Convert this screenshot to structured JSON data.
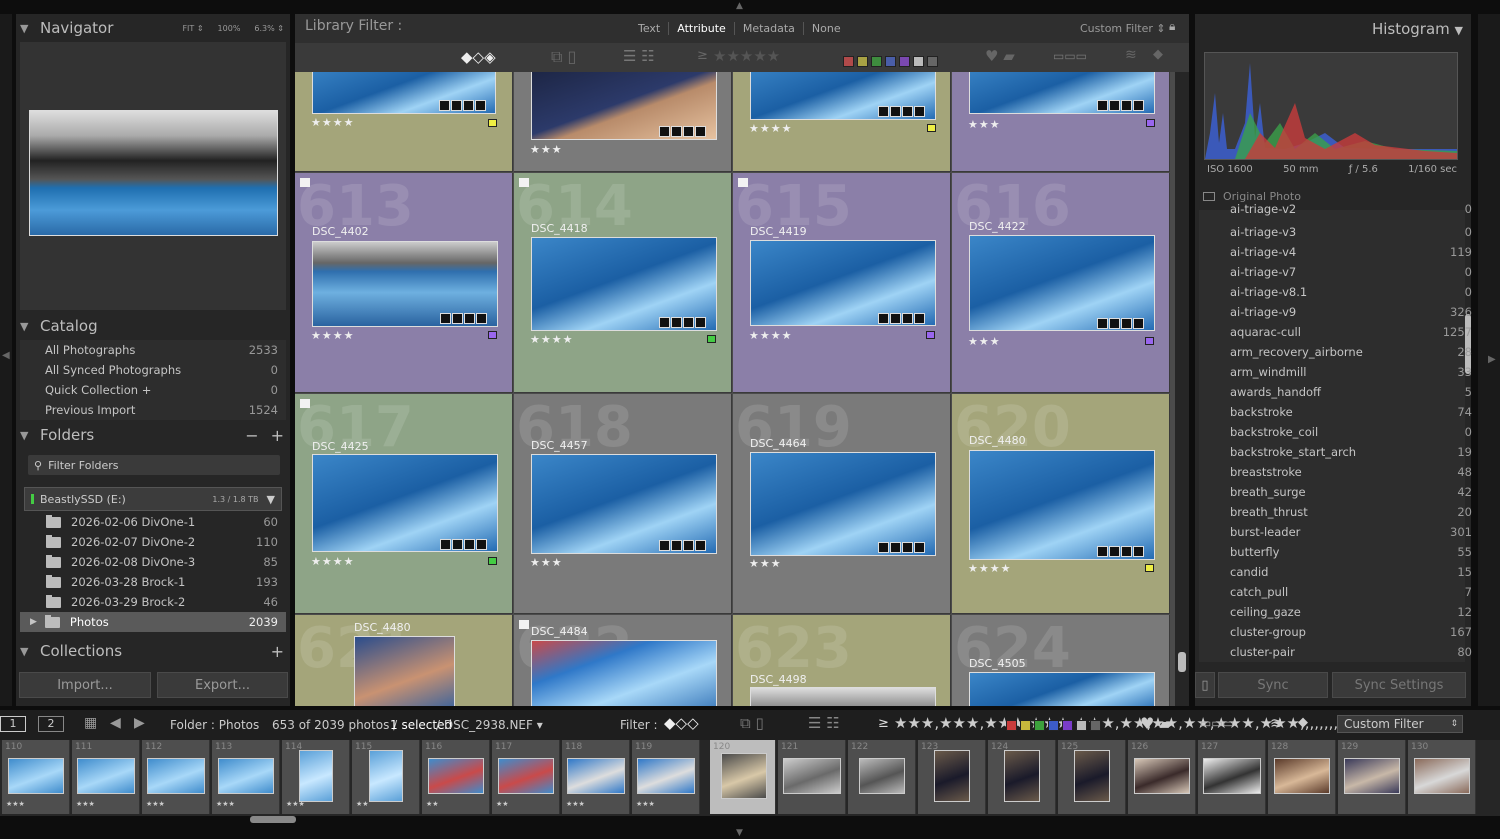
{
  "navigator": {
    "title": "Navigator",
    "zoom": [
      "FIT ⇕",
      "100%",
      "6.3% ⇕"
    ]
  },
  "catalog": {
    "title": "Catalog",
    "items": [
      {
        "label": "All Photographs",
        "count": "2533"
      },
      {
        "label": "All Synced Photographs",
        "count": "0"
      },
      {
        "label": "Quick Collection  +",
        "count": "0"
      },
      {
        "label": "Previous Import",
        "count": "1524"
      }
    ]
  },
  "folders": {
    "title": "Folders",
    "minus": "−",
    "plus": "+",
    "filter_placeholder": "Filter Folders",
    "volume": {
      "name": "BeastlySSD (E:)",
      "space": "1.3 / 1.8 TB"
    },
    "items": [
      {
        "label": "2026-02-06 DivOne-1",
        "count": "60"
      },
      {
        "label": "2026-02-07 DivOne-2",
        "count": "110"
      },
      {
        "label": "2026-02-08 DivOne-3",
        "count": "85"
      },
      {
        "label": "2026-03-28 Brock-1",
        "count": "193"
      },
      {
        "label": "2026-03-29 Brock-2",
        "count": "46"
      },
      {
        "label": "Photos",
        "count": "2039"
      }
    ]
  },
  "collections": {
    "title": "Collections",
    "plus": "+"
  },
  "buttons": {
    "import": "Import...",
    "export": "Export...",
    "sync": "Sync",
    "sync_settings": "Sync Settings"
  },
  "library_filter": {
    "title": "Library Filter :",
    "tabs": [
      "Text",
      "Attribute",
      "Metadata",
      "None"
    ],
    "active": "Attribute",
    "custom": "Custom Filter ⇕",
    "gte": "≥",
    "stars": "★★★★★"
  },
  "colors": {
    "red": "#c84a4a",
    "yellow": "#c8c24a",
    "green": "#4aa04a",
    "blue": "#4a6ac8",
    "purple": "#8a4ac8",
    "label_purple": "#9966ee",
    "label_green": "#44cc44",
    "label_yellow": "#eeee44"
  },
  "grid": {
    "top_row": [
      {
        "stars": "★★★★",
        "label": "yellow"
      },
      {
        "stars": "★★★",
        "label": "none"
      },
      {
        "stars": "★★★★",
        "label": "yellow"
      },
      {
        "stars": "★★★",
        "label": "purple"
      }
    ],
    "rows": [
      [
        {
          "num": "613",
          "name": "DSC_4402",
          "stars": "★★★★",
          "label": "purple",
          "flag": true,
          "bg": "#8b7fa8"
        },
        {
          "num": "614",
          "name": "DSC_4418",
          "stars": "★★★★",
          "label": "green",
          "flag": true,
          "bg": "#8ea487"
        },
        {
          "num": "615",
          "name": "DSC_4419",
          "stars": "★★★★",
          "label": "purple",
          "flag": true,
          "bg": "#8b7fa8"
        },
        {
          "num": "616",
          "name": "DSC_4422",
          "stars": "★★★",
          "label": "purple",
          "flag": false,
          "bg": "#8b7fa8"
        }
      ],
      [
        {
          "num": "617",
          "name": "DSC_4425",
          "stars": "★★★★",
          "label": "green",
          "flag": true,
          "bg": "#8ea487"
        },
        {
          "num": "618",
          "name": "DSC_4457",
          "stars": "★★★",
          "label": "none",
          "flag": false,
          "bg": "#7a7a7a"
        },
        {
          "num": "619",
          "name": "DSC_4464",
          "stars": "★★★",
          "label": "none",
          "flag": false,
          "bg": "#7a7a7a"
        },
        {
          "num": "620",
          "name": "DSC_4480",
          "stars": "★★★★",
          "label": "yellow",
          "flag": false,
          "bg": "#a4a57a"
        }
      ],
      [
        {
          "num": "621",
          "name": "DSC_4480",
          "bg": "#a4a57a",
          "flag": false
        },
        {
          "num": "622",
          "name": "DSC_4484",
          "bg": "#7a7a7a",
          "flag": true
        },
        {
          "num": "623",
          "name": "DSC_4498",
          "bg": "#a4a57a",
          "flag": false
        },
        {
          "num": "624",
          "name": "DSC_4505",
          "bg": "#7a7a7a",
          "flag": false
        }
      ]
    ]
  },
  "histogram": {
    "title": "Histogram",
    "iso": "ISO 1600",
    "focal": "50 mm",
    "aperture": "ƒ / 5.6",
    "shutter": "1/160 sec",
    "original": "Original Photo"
  },
  "keywords": [
    {
      "label": "ai-triage-v2",
      "count": "0"
    },
    {
      "label": "ai-triage-v3",
      "count": "0"
    },
    {
      "label": "ai-triage-v4",
      "count": "119"
    },
    {
      "label": "ai-triage-v7",
      "count": "0"
    },
    {
      "label": "ai-triage-v8.1",
      "count": "0"
    },
    {
      "label": "ai-triage-v9",
      "count": "326"
    },
    {
      "label": "aquarac-cull",
      "count": "1257"
    },
    {
      "label": "arm_recovery_airborne",
      "count": "28"
    },
    {
      "label": "arm_windmill",
      "count": "33"
    },
    {
      "label": "awards_handoff",
      "count": "5"
    },
    {
      "label": "backstroke",
      "count": "74"
    },
    {
      "label": "backstroke_coil",
      "count": "0"
    },
    {
      "label": "backstroke_start_arch",
      "count": "19"
    },
    {
      "label": "breaststroke",
      "count": "48"
    },
    {
      "label": "breath_surge",
      "count": "42"
    },
    {
      "label": "breath_thrust",
      "count": "20"
    },
    {
      "label": "burst-leader",
      "count": "301"
    },
    {
      "label": "butterfly",
      "count": "55"
    },
    {
      "label": "candid",
      "count": "15"
    },
    {
      "label": "catch_pull",
      "count": "7"
    },
    {
      "label": "ceiling_gaze",
      "count": "12"
    },
    {
      "label": "cluster-group",
      "count": "167"
    },
    {
      "label": "cluster-pair",
      "count": "80"
    }
  ],
  "filmstrip": {
    "screen1": "1",
    "screen2": "2",
    "folder": "Folder : Photos",
    "info": "653 of 2039 photos /",
    "selected": "1 selected",
    "file": "/ DSC_2938.NEF ▾",
    "filter": "Filter :",
    "custom": "Custom Filter",
    "gte": "≥",
    "stars": [
      "★★★",
      "★★★",
      "★★★",
      "★★★",
      "★★★",
      "★★",
      "★★",
      "★★",
      "★★★",
      "★★★",
      "",
      "",
      "",
      "",
      "",
      "",
      "",
      "",
      "",
      "",
      ""
    ],
    "numbers": [
      "110",
      "111",
      "112",
      "113",
      "114",
      "115",
      "116",
      "117",
      "118",
      "119",
      "120",
      "121",
      "122",
      "123",
      "124",
      "125",
      "126",
      "127",
      "128",
      "129",
      "130"
    ]
  }
}
